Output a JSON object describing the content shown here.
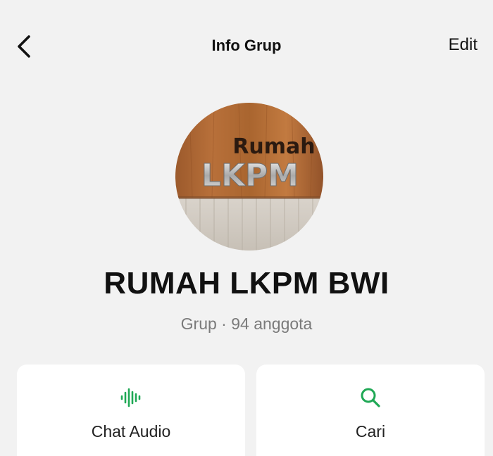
{
  "header": {
    "title": "Info Grup",
    "edit_label": "Edit",
    "back_icon": "chevron-left-icon"
  },
  "group": {
    "name": "RUMAH LKPM BWI",
    "subtitle": "Grup · 94 anggota",
    "avatar_text_line1": "Rumah",
    "avatar_text_line2": "LKPM"
  },
  "actions": [
    {
      "label": "Chat Audio",
      "icon": "audio-waveform-icon"
    },
    {
      "label": "Cari",
      "icon": "search-icon"
    }
  ],
  "colors": {
    "background": "#f2f2f2",
    "card": "#ffffff",
    "accent": "#1fa855",
    "secondary_text": "#7a7a7a"
  }
}
